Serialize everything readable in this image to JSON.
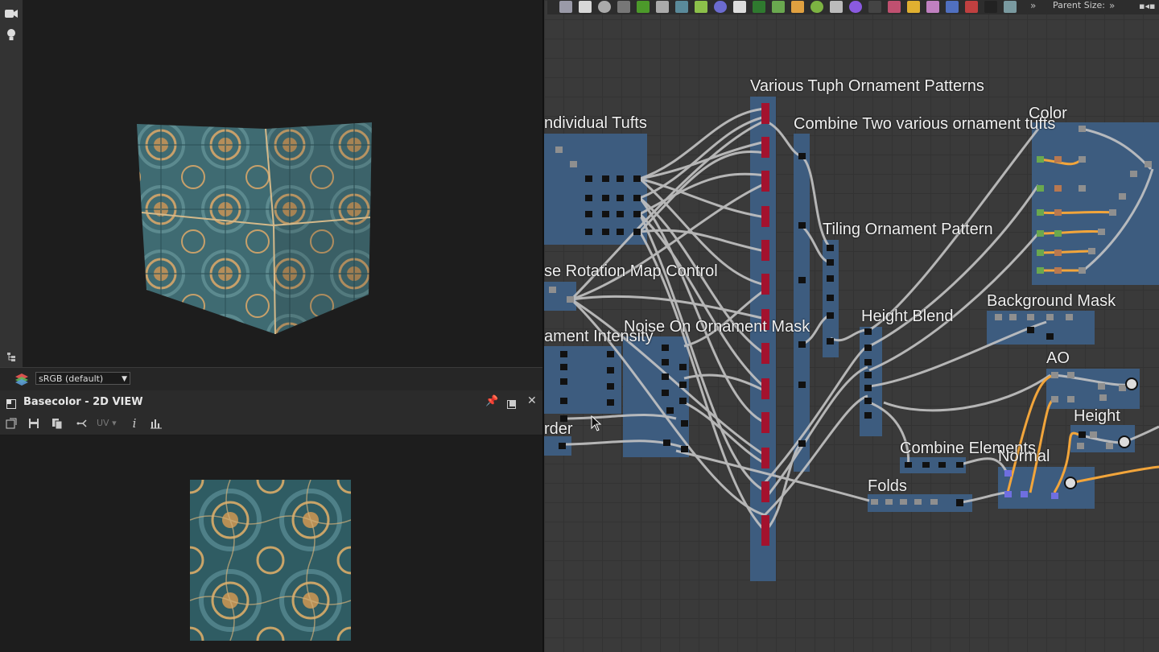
{
  "viewport": {
    "colorspace": "sRGB (default)"
  },
  "view2d": {
    "title": "Basecolor - 2D VIEW",
    "uv_label": "UV"
  },
  "graph": {
    "parent_size_label": "Parent Size:",
    "frames": {
      "various_tuph": "Various Tuph Ornament Patterns",
      "individual_tufts": "ndividual Tufts",
      "combine_two": "Combine Two various ornament tufts",
      "color": "Color",
      "tiling": "Tiling Ornament Pattern",
      "rotation_map": "se Rotation Map Control",
      "height_blend": "Height Blend",
      "background_mask": "Background Mask",
      "noise_mask": "Noise On Ornament Mask",
      "ornament_intensity": "ament Intensity",
      "ao": "AO",
      "height": "Height",
      "border": "rder",
      "combine_elements": "Combine Elements",
      "normal": "Normal",
      "folds": "Folds"
    }
  },
  "colors": {
    "frame": "#3e5f86",
    "wire": "#c4c4c4",
    "wire_orange": "#f2a53b",
    "node_red": "#a3122e",
    "node_black": "#111111"
  }
}
